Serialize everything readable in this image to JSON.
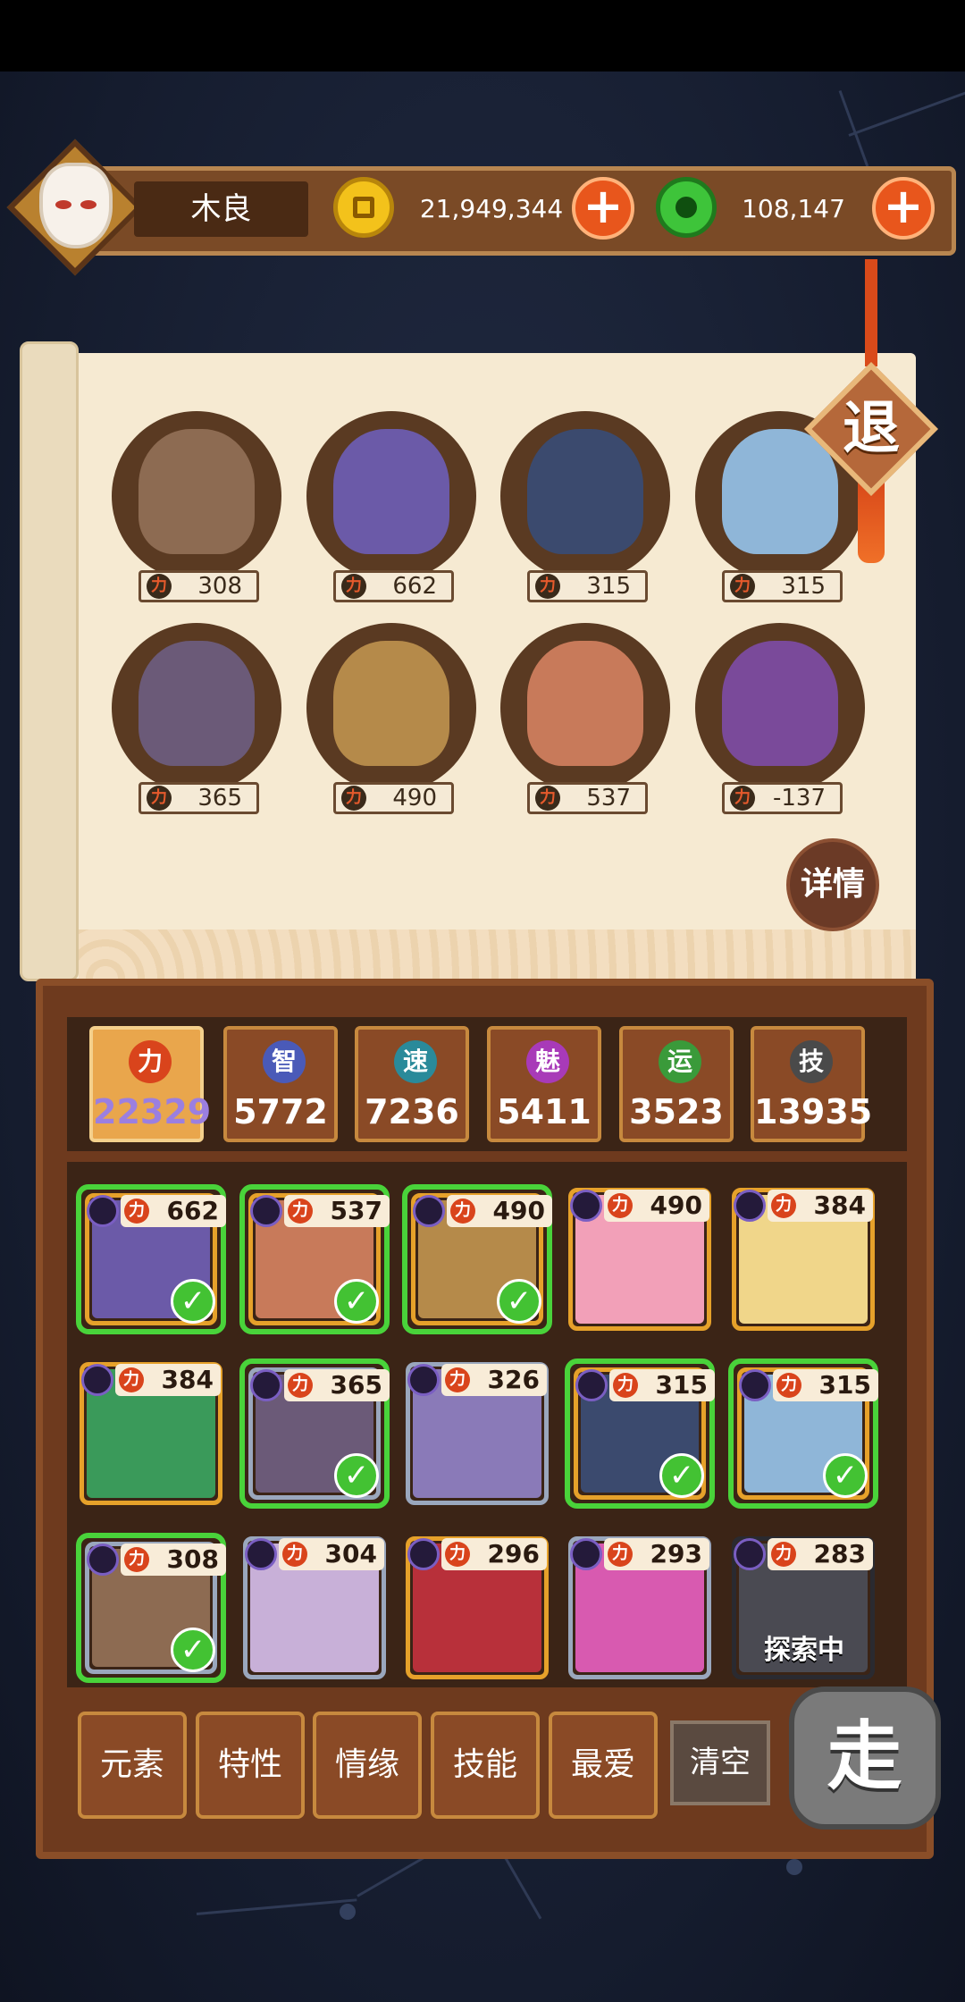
{
  "player": {
    "name": "木良"
  },
  "currency": {
    "coins": "21,949,344",
    "jade": "108,147",
    "add_label": "+"
  },
  "buttons": {
    "retreat": "退",
    "details": "详情",
    "go": "走",
    "clear": "清空"
  },
  "power_icon": "力",
  "lineup": [
    {
      "power": "308",
      "color": "#8d6b52"
    },
    {
      "power": "662",
      "color": "#6b5aa8"
    },
    {
      "power": "315",
      "color": "#3b4a6e"
    },
    {
      "power": "315",
      "color": "#8fb6d8"
    },
    {
      "power": "365",
      "color": "#6b5a78"
    },
    {
      "power": "490",
      "color": "#b58a4a"
    },
    {
      "power": "537",
      "color": "#c87a5a"
    },
    {
      "power": "-137",
      "color": "#7a4a9a"
    }
  ],
  "attributes": [
    {
      "icon": "力",
      "value": "22329",
      "color": "#d9441c",
      "active": true
    },
    {
      "icon": "智",
      "value": "5772",
      "color": "#4a5ab8",
      "active": false
    },
    {
      "icon": "速",
      "value": "7236",
      "color": "#2a8a9a",
      "active": false
    },
    {
      "icon": "魅",
      "value": "5411",
      "color": "#a83ab8",
      "active": false
    },
    {
      "icon": "运",
      "value": "3523",
      "color": "#3a9a3a",
      "active": false
    },
    {
      "icon": "技",
      "value": "13935",
      "color": "#4a4a4a",
      "active": false
    }
  ],
  "roster": [
    {
      "power": "662",
      "selected": true,
      "frame": "gold",
      "art": "#6b5aa8"
    },
    {
      "power": "537",
      "selected": true,
      "frame": "gold",
      "art": "#c87a5a"
    },
    {
      "power": "490",
      "selected": true,
      "frame": "gold",
      "art": "#b58a4a"
    },
    {
      "power": "490",
      "selected": false,
      "frame": "gold",
      "art": "#f2a0b8"
    },
    {
      "power": "384",
      "selected": false,
      "frame": "gold",
      "art": "#f0d68a"
    },
    {
      "power": "384",
      "selected": false,
      "frame": "gold",
      "art": "#3a9a5a"
    },
    {
      "power": "365",
      "selected": true,
      "frame": "silver",
      "art": "#6b5a78"
    },
    {
      "power": "326",
      "selected": false,
      "frame": "silver",
      "art": "#8a7ab8"
    },
    {
      "power": "315",
      "selected": true,
      "frame": "gold",
      "art": "#3b4a6e"
    },
    {
      "power": "315",
      "selected": true,
      "frame": "gold",
      "art": "#8fb6d8"
    },
    {
      "power": "308",
      "selected": true,
      "frame": "silver",
      "art": "#8d6b52"
    },
    {
      "power": "304",
      "selected": false,
      "frame": "silver",
      "art": "#c8b0d8"
    },
    {
      "power": "296",
      "selected": false,
      "frame": "gold",
      "art": "#b8303a"
    },
    {
      "power": "293",
      "selected": false,
      "frame": "silver",
      "art": "#d85ab0"
    },
    {
      "power": "283",
      "selected": false,
      "frame": "dark",
      "art": "#4a4a52",
      "status": "探索中"
    }
  ],
  "filters": [
    "元素",
    "特性",
    "情缘",
    "技能",
    "最爱"
  ]
}
